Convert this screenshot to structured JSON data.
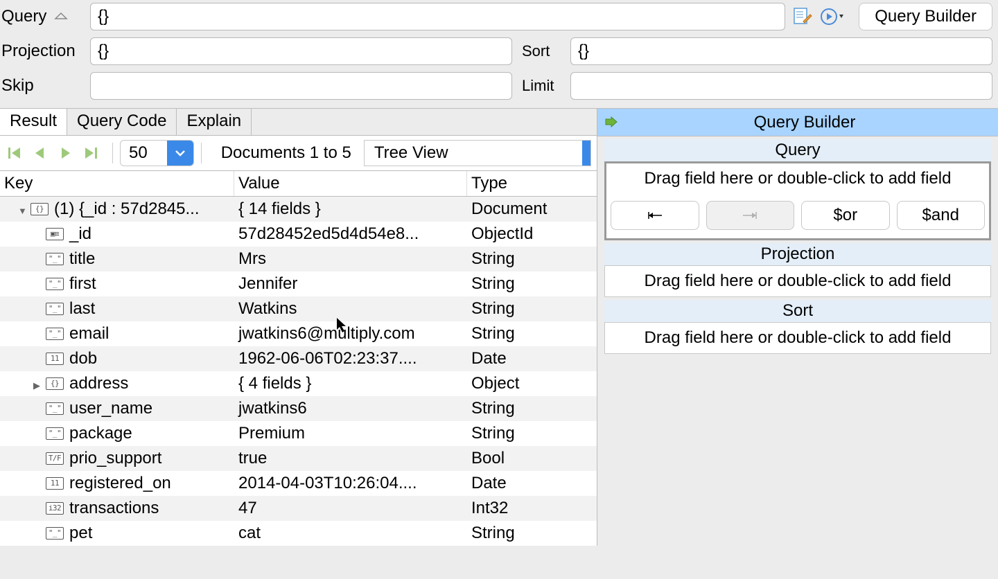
{
  "query_form": {
    "query_label": "Query",
    "query_value": "{}",
    "projection_label": "Projection",
    "projection_value": "{}",
    "sort_label": "Sort",
    "sort_value": "{}",
    "skip_label": "Skip",
    "skip_value": "",
    "limit_label": "Limit",
    "limit_value": "",
    "builder_btn": "Query Builder"
  },
  "tabs": {
    "result": "Result",
    "query_code": "Query Code",
    "explain": "Explain"
  },
  "toolbar": {
    "page_size": "50",
    "doc_range": "Documents 1 to 5",
    "view_mode": "Tree View"
  },
  "tree": {
    "headers": {
      "key": "Key",
      "value": "Value",
      "type": "Type"
    },
    "rows": [
      {
        "indent": 1,
        "disc": "down",
        "icon": "{}",
        "key": "(1) {_id : 57d2845...",
        "value": "{ 14 fields }",
        "type": "Document"
      },
      {
        "indent": 2,
        "icon": "▣≡",
        "key": "_id",
        "value": "57d28452ed5d4d54e8...",
        "type": "ObjectId"
      },
      {
        "indent": 2,
        "icon": "\"_\"",
        "key": "title",
        "value": "Mrs",
        "type": "String"
      },
      {
        "indent": 2,
        "icon": "\"_\"",
        "key": "first",
        "value": "Jennifer",
        "type": "String"
      },
      {
        "indent": 2,
        "icon": "\"_\"",
        "key": "last",
        "value": "Watkins",
        "type": "String"
      },
      {
        "indent": 2,
        "icon": "\"_\"",
        "key": "email",
        "value": "jwatkins6@multiply.com",
        "type": "String"
      },
      {
        "indent": 2,
        "icon": "11",
        "key": "dob",
        "value": "1962-06-06T02:23:37....",
        "type": "Date"
      },
      {
        "indent": 2,
        "disc": "right",
        "icon": "{}",
        "key": "address",
        "value": "{ 4 fields }",
        "type": "Object"
      },
      {
        "indent": 2,
        "icon": "\"_\"",
        "key": "user_name",
        "value": "jwatkins6",
        "type": "String"
      },
      {
        "indent": 2,
        "icon": "\"_\"",
        "key": "package",
        "value": "Premium",
        "type": "String"
      },
      {
        "indent": 2,
        "icon": "T/F",
        "key": "prio_support",
        "value": "true",
        "type": "Bool"
      },
      {
        "indent": 2,
        "icon": "11",
        "key": "registered_on",
        "value": "2014-04-03T10:26:04....",
        "type": "Date"
      },
      {
        "indent": 2,
        "icon": "i32",
        "key": "transactions",
        "value": "47",
        "type": "Int32"
      },
      {
        "indent": 2,
        "icon": "\"_\"",
        "key": "pet",
        "value": "cat",
        "type": "String"
      }
    ]
  },
  "builder": {
    "title": "Query Builder",
    "sections": {
      "query": "Query",
      "projection": "Projection",
      "sort": "Sort"
    },
    "drop_hint": "Drag field here or double-click to add field",
    "buttons": {
      "outdent": "⇤",
      "indent": "⇥",
      "or": "$or",
      "and": "$and"
    }
  }
}
